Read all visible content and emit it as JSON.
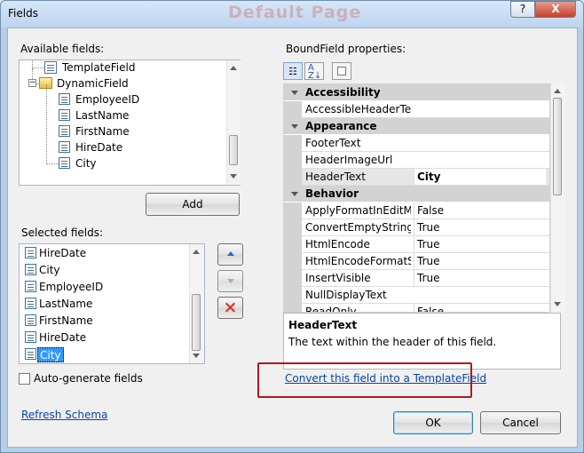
{
  "window": {
    "title": "Fields",
    "background_title": "Default Page",
    "help_button": "?",
    "close_button": "X"
  },
  "available": {
    "label": "Available fields:",
    "items": [
      {
        "label": "TemplateField",
        "icon": "template-field-icon"
      },
      {
        "label": "DynamicField",
        "icon": "folder-icon"
      },
      {
        "label": "EmployeeID",
        "icon": "field-icon"
      },
      {
        "label": "LastName",
        "icon": "field-icon"
      },
      {
        "label": "FirstName",
        "icon": "field-icon"
      },
      {
        "label": "HireDate",
        "icon": "field-icon"
      },
      {
        "label": "City",
        "icon": "field-icon"
      }
    ],
    "add_button": "Add"
  },
  "selected": {
    "label": "Selected fields:",
    "items": [
      {
        "label": "HireDate"
      },
      {
        "label": "City"
      },
      {
        "label": "EmployeeID"
      },
      {
        "label": "LastName"
      },
      {
        "label": "FirstName"
      },
      {
        "label": "HireDate"
      },
      {
        "label": "City",
        "selected": true
      }
    ],
    "auto_generate_label": "Auto-generate fields",
    "auto_generate_checked": false,
    "refresh_label": "Refresh Schema"
  },
  "properties": {
    "label": "BoundField properties:",
    "toolbar_icons": [
      "categorized-icon",
      "alphabetical-icon",
      "property-pages-icon"
    ],
    "categories": [
      {
        "name": "Accessibility",
        "items": [
          {
            "name": "AccessibleHeaderText",
            "value": ""
          }
        ]
      },
      {
        "name": "Appearance",
        "items": [
          {
            "name": "FooterText",
            "value": ""
          },
          {
            "name": "HeaderImageUrl",
            "value": ""
          },
          {
            "name": "HeaderText",
            "value": "City",
            "selected": true
          }
        ]
      },
      {
        "name": "Behavior",
        "items": [
          {
            "name": "ApplyFormatInEditMod",
            "value": "False"
          },
          {
            "name": "ConvertEmptyStringTc",
            "value": "True"
          },
          {
            "name": "HtmlEncode",
            "value": "True"
          },
          {
            "name": "HtmlEncodeFormatStr",
            "value": "True"
          },
          {
            "name": "InsertVisible",
            "value": "True"
          },
          {
            "name": "NullDisplayText",
            "value": ""
          },
          {
            "name": "ReadOnly",
            "value": "False"
          }
        ]
      }
    ],
    "description_title": "HeaderText",
    "description_text": "The text within the header of this field."
  },
  "actions": {
    "convert_link": "Convert this field into a TemplateField",
    "ok": "OK",
    "cancel": "Cancel"
  },
  "colors": {
    "window_blue": "#b6cde9",
    "selection_blue": "#3399ff",
    "link_blue": "#0645ad",
    "highlight_red": "#b3181d",
    "delete_red": "#d73427"
  }
}
